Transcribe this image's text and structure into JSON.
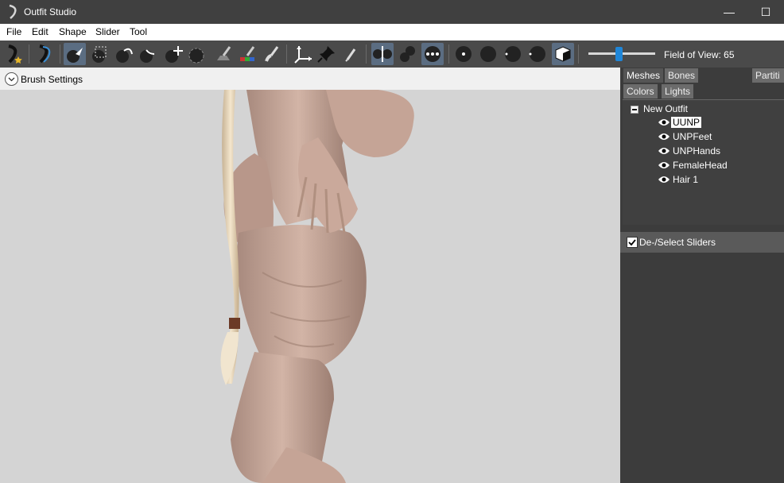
{
  "window": {
    "title": "Outfit Studio",
    "minimize_glyph": "—",
    "maximize_glyph": "☐"
  },
  "menu": [
    "File",
    "Edit",
    "Shape",
    "Slider",
    "Tool"
  ],
  "toolbar": {
    "icons": [
      "new-project-icon",
      "load-outfit-icon",
      "select-brush-icon",
      "mask-select-icon",
      "inflate-brush-icon",
      "deflate-brush-icon",
      "move-brush-icon",
      "smooth-brush-icon",
      "weight-paint-icon",
      "color-paint-icon",
      "alpha-paint-icon",
      "undiff-brush-icon",
      "transform-icon",
      "pivot-icon",
      "vertex-select-icon",
      "x-mirror-icon",
      "connected-only-icon",
      "global-brush-icon",
      "brush-size-small-icon",
      "brush-size-medium-icon",
      "brush-size-large-icon",
      "brush-size-xl-icon",
      "wireframe-cube-icon"
    ],
    "fov_label": "Field of View: 65",
    "fov_value": 65
  },
  "brush_settings": {
    "label": "Brush Settings"
  },
  "tabs": [
    "Meshes",
    "Bones",
    "Partiti",
    "Colors",
    "Lights"
  ],
  "tree": {
    "root": "New Outfit",
    "meshes": [
      {
        "label": "UUNP",
        "selected": true
      },
      {
        "label": "UNPFeet",
        "selected": false
      },
      {
        "label": "UNPHands",
        "selected": false
      },
      {
        "label": "FemaleHead",
        "selected": false
      },
      {
        "label": "Hair 1",
        "selected": false
      }
    ]
  },
  "sliders": {
    "label": "De-/Select Sliders",
    "checked": true
  },
  "colors": {
    "accent": "#1f86d8",
    "active_tool": "#5b6d82",
    "skin": "#c8a89c",
    "hair": "#e8d6b8"
  }
}
